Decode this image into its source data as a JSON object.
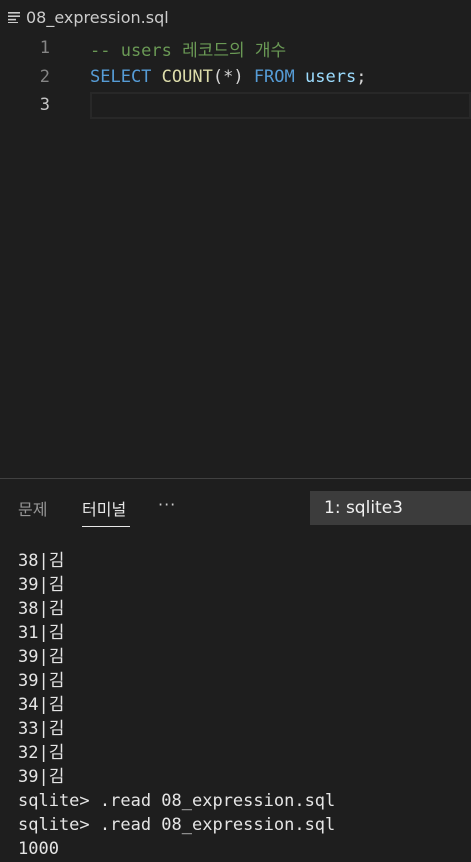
{
  "editor": {
    "filename": "08_expression.sql",
    "file_icon": "lines-icon",
    "lines": [
      {
        "number": "1",
        "tokens": [
          {
            "text": "-- users 레코드의 개수",
            "type": "comment"
          }
        ]
      },
      {
        "number": "2",
        "tokens": [
          {
            "text": "SELECT",
            "type": "keyword"
          },
          {
            "text": " ",
            "type": "punct"
          },
          {
            "text": "COUNT",
            "type": "func"
          },
          {
            "text": "(*) ",
            "type": "punct"
          },
          {
            "text": "FROM",
            "type": "keyword"
          },
          {
            "text": " ",
            "type": "punct"
          },
          {
            "text": "users",
            "type": "ident"
          },
          {
            "text": ";",
            "type": "punct"
          }
        ]
      },
      {
        "number": "3",
        "tokens": []
      }
    ]
  },
  "panel": {
    "tabs": [
      {
        "label": "문제",
        "active": false
      },
      {
        "label": "터미널",
        "active": true
      }
    ],
    "more_label": "···",
    "terminal_selector": "1: sqlite3",
    "terminal_lines": [
      "38|김",
      "39|김",
      "38|김",
      "31|김",
      "39|김",
      "39|김",
      "34|김",
      "33|김",
      "32|김",
      "39|김",
      "sqlite> .read 08_expression.sql",
      "sqlite> .read 08_expression.sql",
      "1000"
    ]
  },
  "colors": {
    "background": "#1e1e1e",
    "comment": "#6a9955",
    "keyword": "#569cd6",
    "function": "#dcdcaa",
    "identifier": "#9cdcfe"
  }
}
